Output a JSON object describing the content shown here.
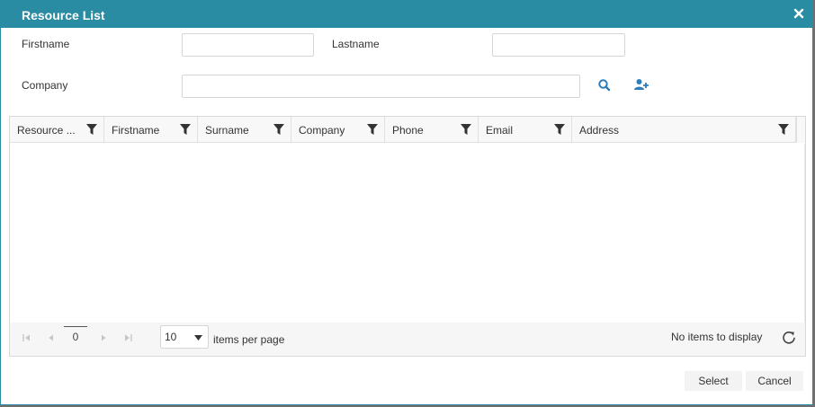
{
  "window": {
    "title": "Resource List"
  },
  "form": {
    "firstname_label": "Firstname",
    "firstname_value": "",
    "lastname_label": "Lastname",
    "lastname_value": "",
    "company_label": "Company",
    "company_value": ""
  },
  "icons": {
    "close": "close-icon",
    "search": "search-icon",
    "add_user": "add-user-icon",
    "filter": "filter-icon",
    "refresh": "refresh-icon"
  },
  "grid": {
    "columns": [
      {
        "title": "Resource ..."
      },
      {
        "title": "Firstname"
      },
      {
        "title": "Surname"
      },
      {
        "title": "Company"
      },
      {
        "title": "Phone"
      },
      {
        "title": "Email"
      },
      {
        "title": "Address"
      }
    ],
    "rows": []
  },
  "pager": {
    "current_page": "0",
    "page_size": "10",
    "items_per_page_label": "items per page",
    "status": "No items to display"
  },
  "footer": {
    "select_label": "Select",
    "cancel_label": "Cancel"
  },
  "colors": {
    "titlebar": "#2a8ca3",
    "icon_accent": "#2e7db8"
  }
}
